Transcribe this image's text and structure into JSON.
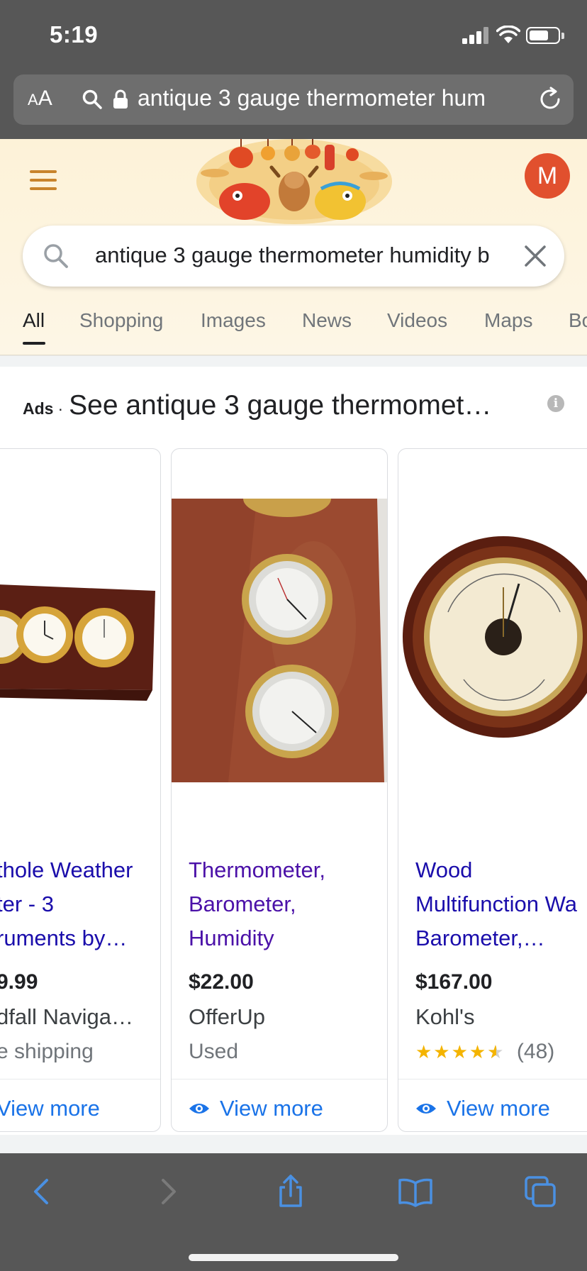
{
  "status_bar": {
    "time": "5:19"
  },
  "safari": {
    "text_size_label": "AA",
    "url_text": "antique 3 gauge thermometer hum"
  },
  "google": {
    "avatar_letter": "M",
    "search_query": "antique 3 gauge thermometer humidity b",
    "tabs": [
      {
        "label": "All",
        "active": true
      },
      {
        "label": "Shopping"
      },
      {
        "label": "Images"
      },
      {
        "label": "News"
      },
      {
        "label": "Videos"
      },
      {
        "label": "Maps"
      },
      {
        "label": "Bo"
      }
    ]
  },
  "ads": {
    "label": "Ads",
    "separator": "·",
    "title": "See antique 3 gauge thermomet…",
    "info_icon": "i",
    "cards": [
      {
        "title": "thole Weather\nter - 3\nruments by…",
        "price": "9.99",
        "seller": "dfall Naviga…",
        "extra": "e shipping",
        "view_more": "View more"
      },
      {
        "title": "Thermometer,\nBarometer,\nHumidity",
        "price": "$22.00",
        "seller": "OfferUp",
        "extra": "Used",
        "view_more": "View more"
      },
      {
        "title": "Wood\nMultifunction Wa\nBarometer,…",
        "price": "$167.00",
        "seller": "Kohl's",
        "rating_stars": 4.5,
        "review_count": "(48)",
        "view_more": "View more"
      }
    ]
  },
  "colors": {
    "safari_chrome": "#575757",
    "link_blue": "#1a73e8",
    "ad_title": "#1a0dab",
    "avatar": "#e1502e",
    "star": "#f4b400"
  }
}
